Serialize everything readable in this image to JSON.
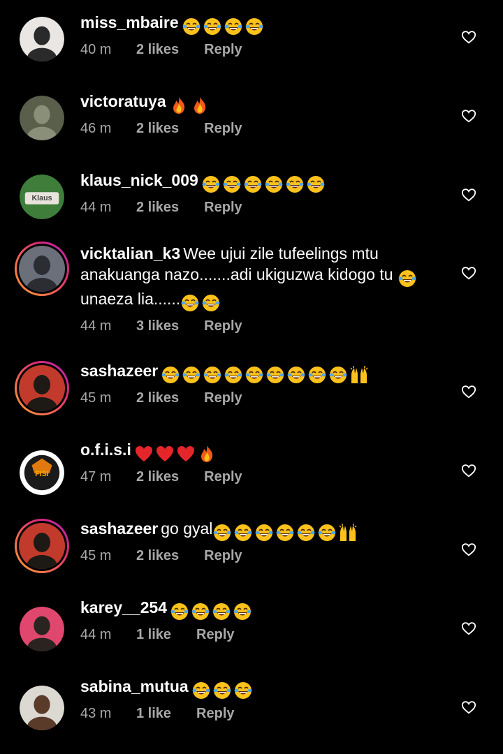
{
  "comments": [
    {
      "username": "miss_mbaire",
      "text": "",
      "emoji_after": [
        "joy",
        "joy",
        "joy",
        "joy"
      ],
      "time": "40 m",
      "likes": "2 likes",
      "reply": "Reply",
      "avatar": "plain",
      "avatar_colors": [
        "#e9e6e3",
        "#2a2a2a"
      ]
    },
    {
      "username": "victoratuya",
      "text": "",
      "emoji_after": [
        "fire",
        "fire"
      ],
      "time": "46 m",
      "likes": "2 likes",
      "reply": "Reply",
      "avatar": "plain",
      "avatar_colors": [
        "#5a5f4c",
        "#8a8f7a"
      ]
    },
    {
      "username": "klaus_nick_009",
      "text": "",
      "emoji_after": [
        "joy",
        "joy",
        "joy",
        "joy",
        "joy",
        "joy"
      ],
      "time": "44 m",
      "likes": "2 likes",
      "reply": "Reply",
      "avatar": "plain",
      "avatar_colors": [
        "#3e7d3a",
        "#e8e4dc"
      ],
      "avatar_label": "Klaus"
    },
    {
      "username": "vicktalian_k3",
      "text": "Wee ujui zile tufeelings mtu anakuanga  nazo.......adi ukiguzwa kidogo tu",
      "line2_lead_emoji": [
        "joy"
      ],
      "line2_text": " unaeza lia......",
      "line2_emoji": [
        "joy",
        "joy"
      ],
      "time": "44 m",
      "likes": "3 likes",
      "reply": "Reply",
      "avatar": "ring",
      "avatar_colors": [
        "#6a6f7a",
        "#2b2d33"
      ]
    },
    {
      "username": "sashazeer",
      "text": "",
      "emoji_after": [
        "joy",
        "joy",
        "joy",
        "joy",
        "joy",
        "joy",
        "joy",
        "joy",
        "joy",
        "raised-hands"
      ],
      "time": "45 m",
      "likes": "2 likes",
      "reply": "Reply",
      "avatar": "ring",
      "avatar_colors": [
        "#c23a2c",
        "#1d1a16"
      ]
    },
    {
      "username": "o.f.i.s.i",
      "text": "",
      "emoji_after": [
        "heart",
        "heart",
        "heart",
        "fire"
      ],
      "time": "47 m",
      "likes": "2 likes",
      "reply": "Reply",
      "avatar": "plain",
      "avatar_colors": [
        "#ffffff",
        "#f2a900"
      ],
      "avatar_label": "FISI"
    },
    {
      "username": "sashazeer",
      "text": "go gyal",
      "emoji_after": [
        "joy",
        "joy",
        "joy",
        "joy",
        "joy",
        "joy",
        "raised-hands"
      ],
      "time": "45 m",
      "likes": "2 likes",
      "reply": "Reply",
      "avatar": "ring",
      "avatar_colors": [
        "#c23a2c",
        "#1d1a16"
      ]
    },
    {
      "username": "karey__254",
      "text": "",
      "emoji_after": [
        "joy",
        "joy",
        "joy",
        "joy"
      ],
      "time": "44 m",
      "likes": "1 like",
      "reply": "Reply",
      "avatar": "plain",
      "avatar_colors": [
        "#e0476e",
        "#2a2420"
      ]
    },
    {
      "username": "sabina_mutua",
      "text": "",
      "emoji_after": [
        "joy",
        "joy",
        "joy"
      ],
      "time": "43 m",
      "likes": "1 like",
      "reply": "Reply",
      "avatar": "plain",
      "avatar_colors": [
        "#dcd8d2",
        "#5a3b2a"
      ]
    }
  ],
  "colors": {
    "background": "#000000",
    "text": "#ffffff",
    "meta": "#a8a8a8",
    "ring_start": "#f9a12e",
    "ring_end": "#b429c2"
  }
}
